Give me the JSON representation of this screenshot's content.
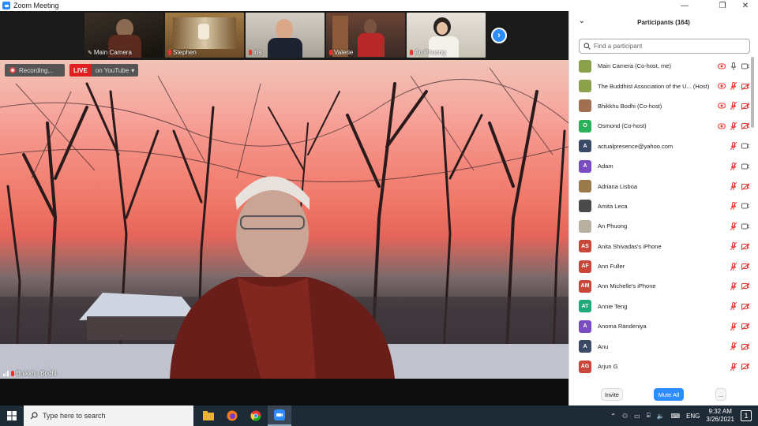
{
  "window": {
    "title": "Zoom Meeting",
    "minimize": "—",
    "maximize": "❐",
    "close": "✕"
  },
  "thumbnails": [
    {
      "name": "Main Camera",
      "color": "#2a2018"
    },
    {
      "name": "Stephen",
      "color": "#8b6a3a"
    },
    {
      "name": "iris",
      "color": "#b9b2a8"
    },
    {
      "name": "Valerie",
      "color": "#5a3a30"
    },
    {
      "name": "An Phuong",
      "color": "#cfcac0"
    }
  ],
  "recording": {
    "label": "Recording..."
  },
  "live": {
    "tag": "LIVE",
    "destination": "on YouTube"
  },
  "active_speaker": {
    "name": "Bhikkhu Bodhi"
  },
  "participants": {
    "title": "Participants (164)",
    "search_placeholder": "Find a participant",
    "list": [
      {
        "name": "Main Camera (Co-host, me)",
        "initials": "",
        "color": "#8aa04a",
        "mic": "on",
        "video": "on",
        "rec": true
      },
      {
        "name": "The Buddhist Association of the U... (Host)",
        "initials": "",
        "color": "#8aa04a",
        "mic": "off",
        "video": "off",
        "rec": true
      },
      {
        "name": "Bhikkhu Bodhi (Co-host)",
        "initials": "",
        "color": "#a07050",
        "mic": "off",
        "video": "off",
        "rec": true
      },
      {
        "name": "Osmond (Co-host)",
        "initials": "O",
        "color": "#2bb15a",
        "mic": "off",
        "video": "off",
        "rec": true
      },
      {
        "name": "actualpresence@yahoo.com",
        "initials": "A",
        "color": "#3a4a66",
        "mic": "off",
        "video": "on",
        "rec": false
      },
      {
        "name": "Adam",
        "initials": "A",
        "color": "#7a4cc2",
        "mic": "off",
        "video": "on",
        "rec": false
      },
      {
        "name": "Adriana Lisboa",
        "initials": "",
        "color": "#9a7a4a",
        "mic": "off",
        "video": "off",
        "rec": false
      },
      {
        "name": "Amita Leca",
        "initials": "",
        "color": "#4a4a4a",
        "mic": "off",
        "video": "on",
        "rec": false
      },
      {
        "name": "An Phuong",
        "initials": "",
        "color": "#b8b0a0",
        "mic": "off",
        "video": "on",
        "rec": false
      },
      {
        "name": "Anita Shivadas's iPhone",
        "initials": "AS",
        "color": "#c8463a",
        "mic": "off",
        "video": "off",
        "rec": false
      },
      {
        "name": "Ann Fuller",
        "initials": "AF",
        "color": "#c8463a",
        "mic": "off",
        "video": "off",
        "rec": false
      },
      {
        "name": "Ann Michelle's iPhone",
        "initials": "AM",
        "color": "#c8463a",
        "mic": "off",
        "video": "off",
        "rec": false
      },
      {
        "name": "Annie Teng",
        "initials": "AT",
        "color": "#1fa97a",
        "mic": "off",
        "video": "off",
        "rec": false
      },
      {
        "name": "Anoma Randeniya",
        "initials": "A",
        "color": "#7a4cc2",
        "mic": "off",
        "video": "off",
        "rec": false
      },
      {
        "name": "Anu",
        "initials": "A",
        "color": "#3a4a66",
        "mic": "off",
        "video": "off",
        "rec": false
      },
      {
        "name": "Arjun G",
        "initials": "AG",
        "color": "#c8463a",
        "mic": "off",
        "video": "off",
        "rec": false
      }
    ],
    "invite_label": "Invite",
    "mute_all_label": "Mute All",
    "more_label": "..."
  },
  "taskbar": {
    "search_placeholder": "Type here to search",
    "language": "ENG",
    "time": "9:32 AM",
    "date": "3/26/2021",
    "notification_count": "1"
  }
}
